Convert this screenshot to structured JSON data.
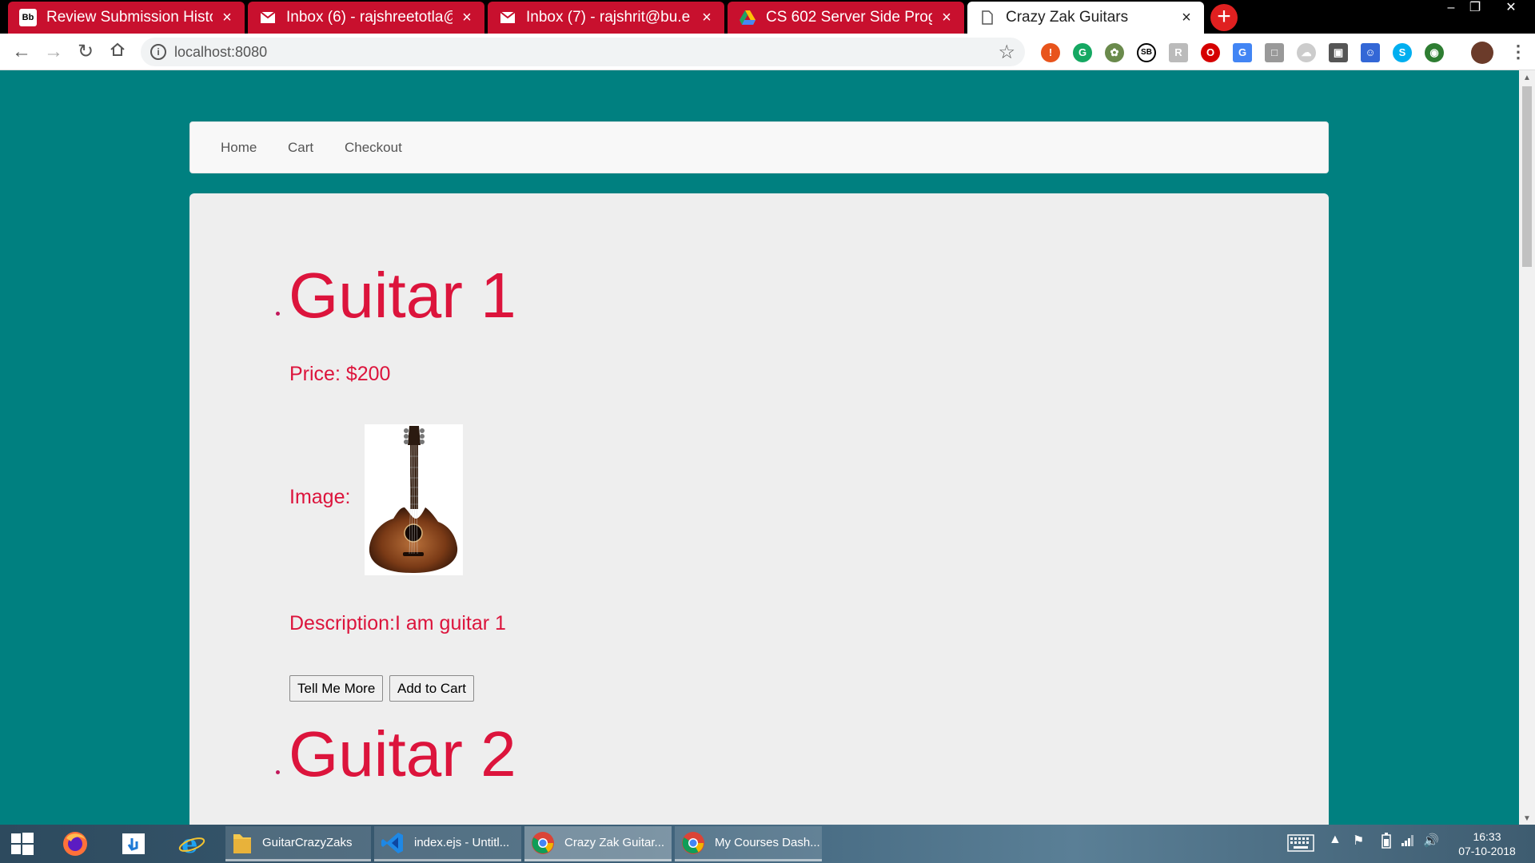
{
  "browser": {
    "tabs": [
      {
        "title": "Review Submission Histo",
        "favicon": "Bb",
        "active": false
      },
      {
        "title": "Inbox (6) - rajshreetotla@",
        "favicon": "gmail",
        "active": false
      },
      {
        "title": "Inbox (7) - rajshrit@bu.e",
        "favicon": "gmail",
        "active": false
      },
      {
        "title": "CS 602 Server Side Prog",
        "favicon": "drive",
        "active": false
      },
      {
        "title": "Crazy Zak Guitars",
        "favicon": "page",
        "active": true
      }
    ],
    "close_glyph": "×",
    "new_tab_glyph": "+",
    "url": "localhost:8080"
  },
  "site": {
    "nav": [
      "Home",
      "Cart",
      "Checkout"
    ],
    "guitars": [
      {
        "title": "Guitar 1",
        "price": "Price: $200",
        "image_label": "Image:",
        "description": "Description:I am guitar 1",
        "tell_me_more": "Tell Me More",
        "add_to_cart": "Add to Cart"
      },
      {
        "title": "Guitar 2"
      }
    ]
  },
  "taskbar": {
    "apps": [
      {
        "label": "GuitarCrazyZaks",
        "icon": "folder-icon"
      },
      {
        "label": "index.ejs - Untitl...",
        "icon": "vscode-icon"
      },
      {
        "label": "Crazy Zak Guitar...",
        "icon": "chrome-icon"
      },
      {
        "label": "My Courses Dash...",
        "icon": "chrome-icon"
      }
    ],
    "time": "16:33",
    "date": "07-10-2018"
  },
  "colors": {
    "page_bg": "#008080",
    "accent": "#dc143c",
    "tab_bg": "#c8102e"
  }
}
